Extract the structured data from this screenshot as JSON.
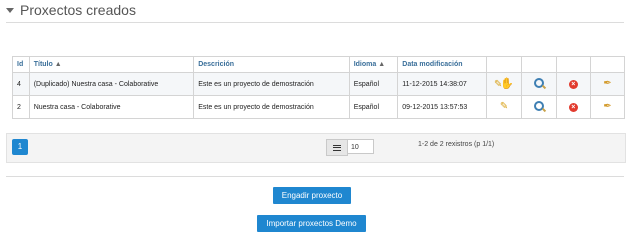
{
  "section": {
    "title": "Proxectos creados"
  },
  "table": {
    "columns": [
      "Id",
      "Título",
      "Descrición",
      "Idioma",
      "Data modificación"
    ],
    "rows": [
      {
        "id": "4",
        "title": "(Duplicado) Nuestra casa - Colaborative",
        "description": "Este es un proyecto de demostración",
        "language": "Español",
        "modified": "11-12-2015 14:38:07"
      },
      {
        "id": "2",
        "title": "Nuestra casa - Colaborative",
        "description": "Este es un proyecto de demostración",
        "language": "Español",
        "modified": "09-12-2015 13:57:53"
      }
    ]
  },
  "pager": {
    "current_page": "1",
    "page_size": "10",
    "records_info": "1-2 de 2 rexistros (p 1/1)"
  },
  "buttons": {
    "add_project": "Engadir proxecto",
    "import_demo": "Importar proxectos Demo"
  },
  "icons": {
    "edit": "pencil-icon",
    "view": "magnifier-icon",
    "delete": "delete-icon",
    "duplicate": "pencil-icon",
    "sort": "sort-up-icon",
    "list": "list-icon"
  },
  "colors": {
    "accent": "#1f87d0",
    "header_text": "#3a6f9a",
    "delete": "#e23b2e",
    "edit": "#d8a21a"
  }
}
